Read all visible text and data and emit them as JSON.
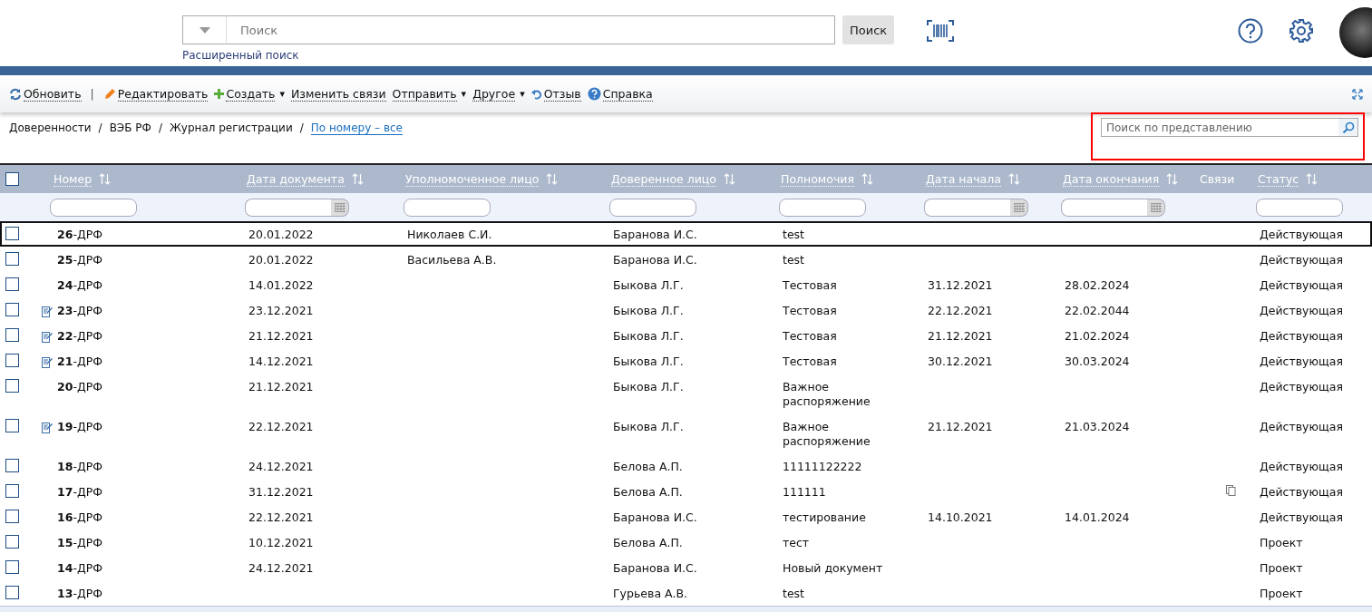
{
  "header": {
    "search": {
      "placeholder": "Поиск",
      "button": "Поиск",
      "advanced_link": "Расширенный поиск"
    }
  },
  "toolbar": [
    {
      "label": "Обновить",
      "kind": "refresh"
    },
    {
      "label": "|",
      "kind": "separator"
    },
    {
      "label": "Редактировать",
      "kind": "edit"
    },
    {
      "label": "Создать",
      "kind": "create",
      "caret": "▾"
    },
    {
      "label": "Изменить связи",
      "kind": "plain"
    },
    {
      "label": "Отправить",
      "kind": "plain",
      "caret": "▾"
    },
    {
      "label": "Другое",
      "kind": "plain",
      "caret": "▾"
    },
    {
      "label": "Отзыв",
      "kind": "feedback"
    },
    {
      "label": "Справка",
      "kind": "help"
    }
  ],
  "breadcrumbs": [
    {
      "label": "Доверенности",
      "kind": "crumb"
    },
    {
      "label": "/",
      "kind": "separator"
    },
    {
      "label": "ВЭБ РФ",
      "kind": "crumb"
    },
    {
      "label": "/",
      "kind": "separator"
    },
    {
      "label": "Журнал регистрации",
      "kind": "crumb"
    },
    {
      "label": "/",
      "kind": "separator"
    },
    {
      "label": "По номеру – все",
      "kind": "link"
    }
  ],
  "view_search": {
    "placeholder": "Поиск по представлению",
    "highlighted": true
  },
  "table": {
    "select_all_checked": false,
    "columns": [
      {
        "label": "Номер",
        "kind": "text"
      },
      {
        "label": "Дата документа",
        "kind": "date"
      },
      {
        "label": "Уполномоченное лицо",
        "kind": "text"
      },
      {
        "label": "Доверенное лицо",
        "kind": "text"
      },
      {
        "label": "Полномочия",
        "kind": "text"
      },
      {
        "label": "Дата начала",
        "kind": "date"
      },
      {
        "label": "Дата окончания",
        "kind": "date"
      },
      {
        "label": "Связи",
        "kind": "plain"
      },
      {
        "label": "Статус",
        "kind": "text"
      }
    ],
    "rows": [
      {
        "selected": true,
        "checked": false,
        "edited": false,
        "has_links": false,
        "cells": [
          "**26**-ДРФ",
          "20.01.2022",
          "Николаев С.И.",
          "Баранова И.С.",
          "test",
          "",
          "",
          "",
          "Действующая"
        ]
      },
      {
        "selected": false,
        "checked": false,
        "edited": false,
        "has_links": false,
        "cells": [
          "**25**-ДРФ",
          "20.01.2022",
          "Васильева А.В.",
          "Баранова И.С.",
          "test",
          "",
          "",
          "",
          "Действующая"
        ]
      },
      {
        "selected": false,
        "checked": false,
        "edited": false,
        "has_links": false,
        "cells": [
          "**24**-ДРФ",
          "14.01.2022",
          "",
          "Быкова Л.Г.",
          "Тестовая",
          "31.12.2021",
          "28.02.2024",
          "",
          "Действующая"
        ]
      },
      {
        "selected": false,
        "checked": false,
        "edited": true,
        "has_links": false,
        "cells": [
          "**23**-ДРФ",
          "23.12.2021",
          "",
          "Быкова Л.Г.",
          "Тестовая",
          "22.12.2021",
          "22.02.2044",
          "",
          "Действующая"
        ]
      },
      {
        "selected": false,
        "checked": false,
        "edited": true,
        "has_links": false,
        "cells": [
          "**22**-ДРФ",
          "21.12.2021",
          "",
          "Быкова Л.Г.",
          "Тестовая",
          "21.12.2021",
          "21.02.2024",
          "",
          "Действующая"
        ]
      },
      {
        "selected": false,
        "checked": false,
        "edited": true,
        "has_links": false,
        "cells": [
          "**21**-ДРФ",
          "14.12.2021",
          "",
          "Быкова Л.Г.",
          "Тестовая",
          "30.12.2021",
          "30.03.2024",
          "",
          "Действующая"
        ]
      },
      {
        "selected": false,
        "checked": false,
        "edited": false,
        "has_links": false,
        "cells": [
          "**20**-ДРФ",
          "21.12.2021",
          "",
          "Быкова Л.Г.",
          "Важное распоряжение",
          "",
          "",
          "",
          "Действующая"
        ]
      },
      {
        "selected": false,
        "checked": false,
        "edited": true,
        "has_links": false,
        "cells": [
          "**19**-ДРФ",
          "22.12.2021",
          "",
          "Быкова Л.Г.",
          "Важное распоряжение",
          "21.12.2021",
          "21.03.2024",
          "",
          "Действующая"
        ]
      },
      {
        "selected": false,
        "checked": false,
        "edited": false,
        "has_links": false,
        "cells": [
          "**18**-ДРФ",
          "24.12.2021",
          "",
          "Белова А.П.",
          "11111122222",
          "",
          "",
          "",
          "Действующая"
        ]
      },
      {
        "selected": false,
        "checked": false,
        "edited": false,
        "has_links": true,
        "cells": [
          "**17**-ДРФ",
          "31.12.2021",
          "",
          "Белова А.П.",
          "111111",
          "",
          "",
          "",
          "Действующая"
        ]
      },
      {
        "selected": false,
        "checked": false,
        "edited": false,
        "has_links": false,
        "cells": [
          "**16**-ДРФ",
          "22.12.2021",
          "",
          "Баранова И.С.",
          "тестирование",
          "14.10.2021",
          "14.01.2024",
          "",
          "Действующая"
        ]
      },
      {
        "selected": false,
        "checked": false,
        "edited": false,
        "has_links": false,
        "cells": [
          "**15**-ДРФ",
          "10.12.2021",
          "",
          "Белова А.П.",
          "тест",
          "",
          "",
          "",
          "Проект"
        ]
      },
      {
        "selected": false,
        "checked": false,
        "edited": false,
        "has_links": false,
        "cells": [
          "**14**-ДРФ",
          "24.12.2021",
          "",
          "Баранова И.С.",
          "Новый документ",
          "",
          "",
          "",
          "Проект"
        ]
      },
      {
        "selected": false,
        "checked": false,
        "edited": false,
        "has_links": false,
        "cells": [
          "**13**-ДРФ",
          "",
          "",
          "Гурьева А.В.",
          "test",
          "",
          "",
          "",
          "Проект"
        ]
      }
    ]
  }
}
